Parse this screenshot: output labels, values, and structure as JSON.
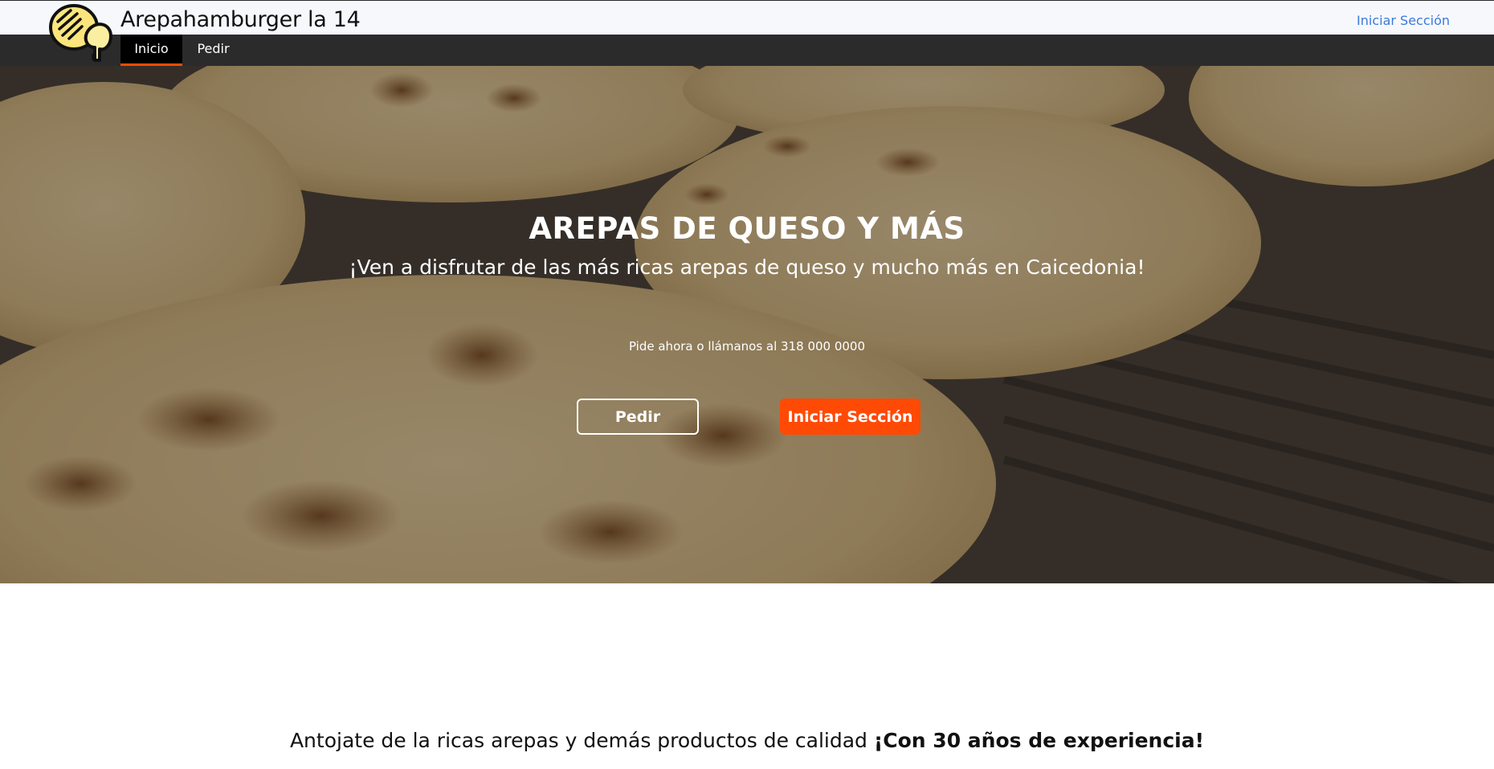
{
  "header": {
    "brand": "Arepahamburger la 14",
    "login_link": "Iniciar Sección",
    "logo_icon": "arepa-logo-icon"
  },
  "nav": {
    "items": [
      {
        "label": "Inicio",
        "active": true
      },
      {
        "label": "Pedir",
        "active": false
      }
    ]
  },
  "hero": {
    "title": "AREPAS DE QUESO Y MÁS",
    "subtitle": "¡Ven a disfrutar de las más ricas arepas de queso y mucho más en Caicedonia!",
    "call_text": "Pide ahora o llámanos al 318 000 0000",
    "buttons": {
      "order": "Pedir",
      "login": "Iniciar Sección"
    }
  },
  "tagline": {
    "text": "Antojate de la ricas arepas y demás productos de calidad ",
    "emphasis": "¡Con 30 años de experiencia!"
  },
  "colors": {
    "accent": "#ff4a05",
    "navbar": "#2b2b2b",
    "link": "#3b7ad9"
  }
}
